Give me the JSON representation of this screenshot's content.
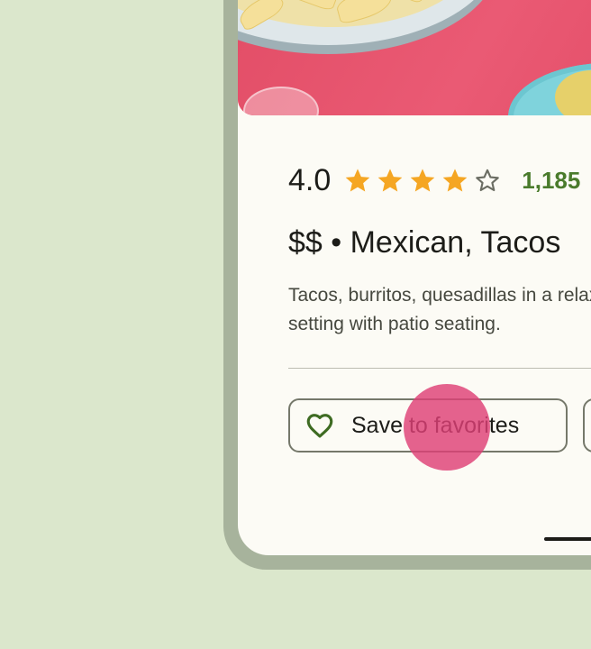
{
  "listing": {
    "rating": "4.0",
    "stars": {
      "filled": 4,
      "total": 5
    },
    "review_count": "1,185",
    "price_and_category": "$$ • Mexican, Tacos",
    "description": "Tacos, burritos, quesadillas in a relaxed setting with patio seating.",
    "photo_icon": "food-photo-icon"
  },
  "actions": {
    "save_label": "Save to favorites",
    "save_icon": "heart-outline-icon"
  },
  "colors": {
    "background": "#dbe7cc",
    "frame": "#a7b39c",
    "surface": "#fcfbf5",
    "star": "#f5a623",
    "accent_green": "#4a7b2c",
    "touch_indicator": "#de4076"
  }
}
